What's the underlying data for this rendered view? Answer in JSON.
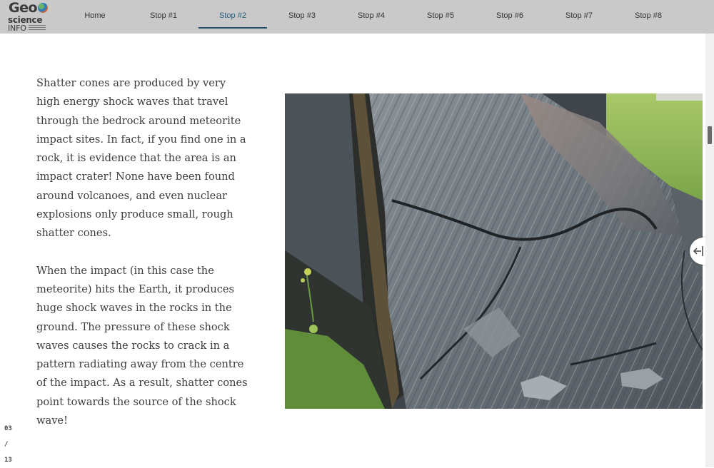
{
  "logo": {
    "line1": "Geo",
    "line2": "science",
    "line3": "INFO"
  },
  "nav": {
    "items": [
      {
        "label": "Home"
      },
      {
        "label": "Stop #1"
      },
      {
        "label": "Stop #2"
      },
      {
        "label": "Stop #3"
      },
      {
        "label": "Stop #4"
      },
      {
        "label": "Stop #5"
      },
      {
        "label": "Stop #6"
      },
      {
        "label": "Stop #7"
      },
      {
        "label": "Stop #8"
      }
    ],
    "active_index": 2
  },
  "content": {
    "paragraphs": [
      "Shatter cones are produced by very high energy shock waves that travel through the bedrock around meteorite impact sites. In fact, if you find one in a rock, it is evidence that the area is an impact crater! None have been found around volcanoes, and even nuclear explosions only produce small, rough shatter cones.",
      "When the impact (in this case the meteorite) hits the Earth, it produces huge shock waves in the rocks in the ground. The pressure of these shock waves causes the rocks to crack in a pattern radiating away from the centre of the impact. As a result, shatter cones point towards the source of the shock wave!"
    ]
  },
  "progress": {
    "current": "03",
    "separator": "/",
    "total": "13"
  },
  "colors": {
    "topbar": "#c9c9c9",
    "active_nav": "#1f4f6b",
    "body_text": "#3c3c3c"
  }
}
